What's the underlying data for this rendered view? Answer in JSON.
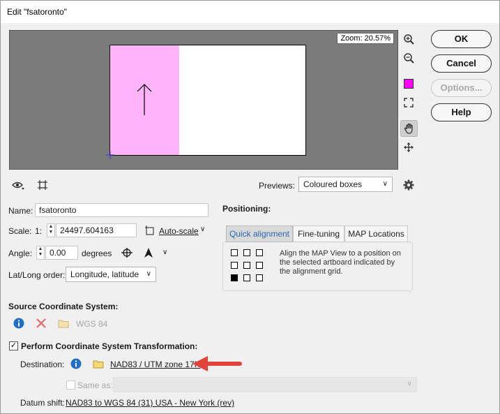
{
  "window": {
    "title": "Edit \"fsatoronto\""
  },
  "preview": {
    "zoom_label": "Zoom: 20.57%"
  },
  "buttons": {
    "ok": "OK",
    "cancel": "Cancel",
    "options": "Options...",
    "help": "Help"
  },
  "toolbar": {
    "previews_label": "Previews:",
    "previews_value": "Coloured boxes"
  },
  "fields": {
    "name_label": "Name:",
    "name_value": "fsatoronto",
    "scale_label": "Scale:",
    "scale_prefix": "1:",
    "scale_value": "24497.604163",
    "autoscale_label": "Auto-scale",
    "angle_label": "Angle:",
    "angle_value": "0.00",
    "angle_unit": "degrees",
    "latlong_label": "Lat/Long order:",
    "latlong_value": "Longitude, latitude"
  },
  "positioning": {
    "heading": "Positioning:",
    "tabs": [
      {
        "label": "Quick alignment",
        "active": true
      },
      {
        "label": "Fine-tuning",
        "active": false
      },
      {
        "label": "MAP Locations",
        "active": false
      }
    ],
    "description": "Align the MAP View to a position on the selected artboard indicated by the alignment grid.",
    "grid_selected": "bottom-left"
  },
  "source": {
    "heading": "Source Coordinate System:",
    "value": "WGS 84"
  },
  "transform": {
    "checkbox_label": "Perform Coordinate System Transformation:",
    "checked": true,
    "destination_label": "Destination:",
    "destination_value": "NAD83 / UTM zone 17N",
    "same_as_label": "Same as:",
    "datum_label": "Datum shift:",
    "datum_value": "NAD83 to WGS 84 (31) USA - New York (rev)"
  },
  "colors": {
    "accent": "#2b67b5",
    "swatch": "#ff00ff",
    "pink_box": "#ffb3f8",
    "arrow": "#e3423b",
    "info": "#1f6fc5",
    "error": "#e36b6b"
  }
}
